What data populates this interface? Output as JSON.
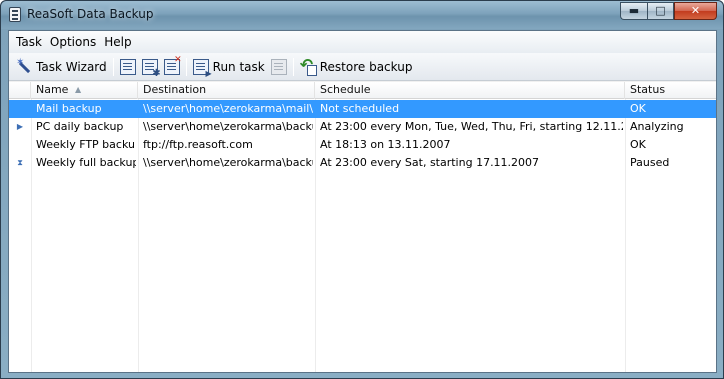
{
  "window": {
    "title": "ReaSoft Data Backup",
    "controls": {
      "minimize": "▬",
      "maximize": "□",
      "close": "✕"
    }
  },
  "menu": [
    "Task",
    "Options",
    "Help"
  ],
  "toolbar": {
    "task_wizard": "Task Wizard",
    "run_task": "Run task",
    "restore_backup": "Restore backup"
  },
  "list": {
    "columns": [
      "Name",
      "Destination",
      "Schedule",
      "Status"
    ],
    "sort_column": "Name",
    "sort_indicator": "▲",
    "rows": [
      {
        "icon": "",
        "name": "Mail backup",
        "destination": "\\\\server\\home\\zerokarma\\mail\\",
        "schedule": "Not scheduled",
        "status": "OK",
        "selected": true
      },
      {
        "icon": "▶",
        "name": "PC daily backup",
        "destination": "\\\\server\\home\\zerokarma\\backup\\",
        "schedule": "At 23:00 every Mon, Tue, Wed, Thu, Fri, starting 12.11.2007",
        "status": "Analyzing",
        "selected": false
      },
      {
        "icon": "",
        "name": "Weekly FTP backup",
        "destination": "ftp://ftp.reasoft.com",
        "schedule": "At 18:13 on 13.11.2007",
        "status": "OK",
        "selected": false
      },
      {
        "icon": "⧗",
        "name": "Weekly full backup",
        "destination": "\\\\server\\home\\zerokarma\\backup\\",
        "schedule": "At 23:00 every Sat, starting 17.11.2007",
        "status": "Paused",
        "selected": false
      }
    ]
  },
  "colors": {
    "selection": "#3399ff",
    "title_bar": "#7da2bb",
    "close_button": "#c23b1f"
  }
}
